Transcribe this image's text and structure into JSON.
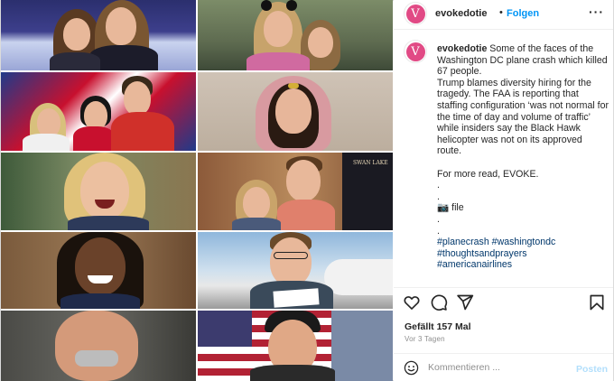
{
  "post": {
    "username": "evokedotie",
    "dot": "•",
    "follow_label": "Folgen",
    "more_icon": "more-horizontal-icon",
    "avatar_letter": "V",
    "brand_color": "#e14a85"
  },
  "caption": {
    "username": "evokedotie",
    "lines": [
      "Some of the faces of the Washington DC plane crash which killed 67 people.",
      "Trump blames diversity hiring for the tragedy. The FAA is reporting that staffing configuration ‘was not normal for the time of day and volume of traffic’ while insiders say the Black Hawk helicopter was not on its approved route."
    ],
    "more_read": "For more read, EVOKE.",
    "dots": [
      ".",
      ".",
      "."
    ],
    "file_line": "📷 file",
    "dots2": [
      ".",
      "."
    ],
    "hashtags": [
      "#planecrash",
      "#washingtondc",
      "#thoughtsandprayers",
      "#americanairlines"
    ]
  },
  "actions": {
    "icons": [
      "heart-icon",
      "comment-icon",
      "share-icon",
      "bookmark-icon"
    ]
  },
  "likes": "Gefällt 157 Mal",
  "timestamp": "Vor 3 Tagen",
  "comment_box": {
    "placeholder": "Kommentieren ...",
    "post_label": "Posten",
    "emoji_icon": "emoji-icon"
  },
  "colors": {
    "link": "#00376b",
    "follow": "#0095f6",
    "post_disabled": "#b2dffc"
  }
}
